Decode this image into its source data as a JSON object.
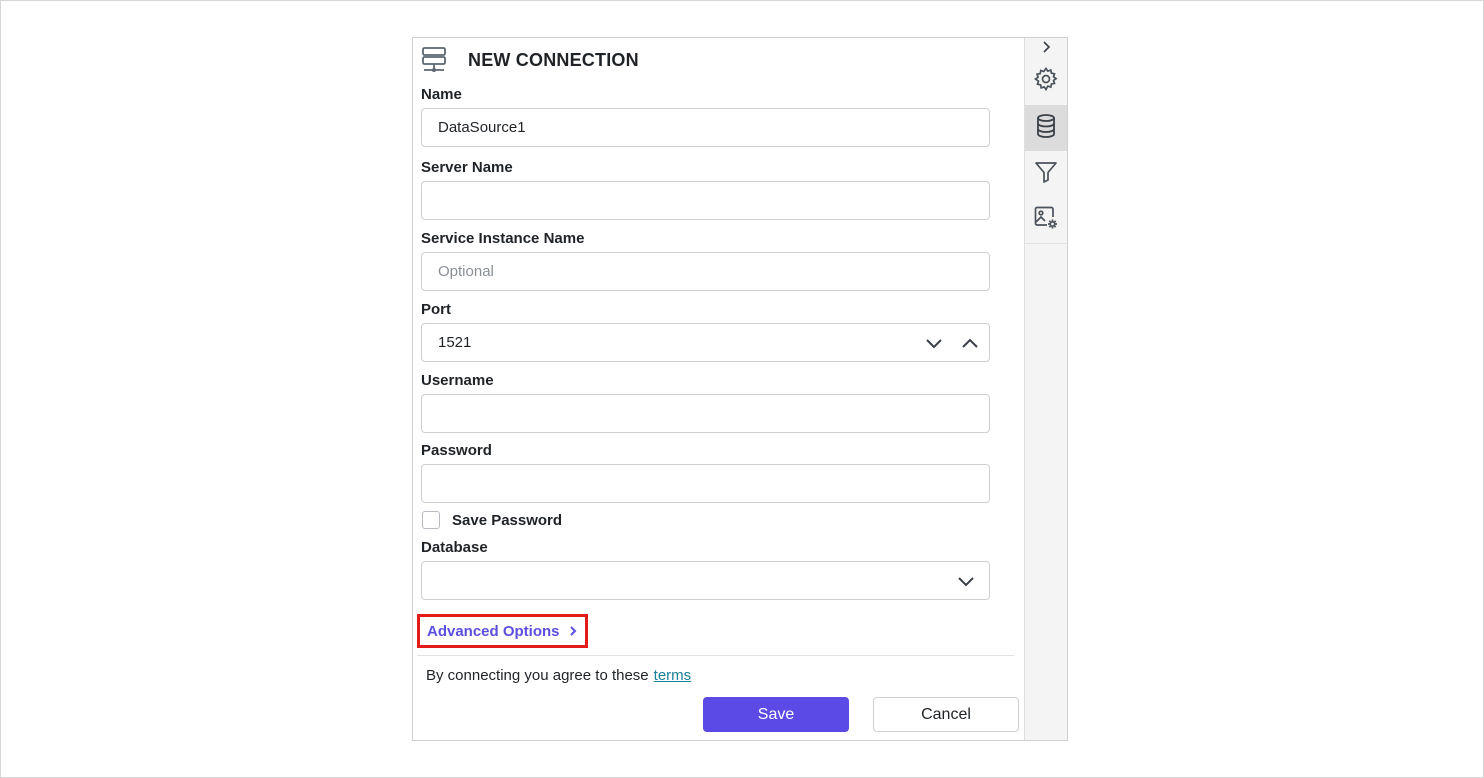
{
  "panel": {
    "title": "NEW CONNECTION",
    "title_icon": "server-icon"
  },
  "form": {
    "name": {
      "label": "Name",
      "value": "DataSource1"
    },
    "server_name": {
      "label": "Server Name",
      "value": ""
    },
    "service_instance_name": {
      "label": "Service Instance Name",
      "placeholder": "Optional",
      "value": ""
    },
    "port": {
      "label": "Port",
      "value": "1521"
    },
    "username": {
      "label": "Username",
      "value": ""
    },
    "password": {
      "label": "Password",
      "value": ""
    },
    "save_password": {
      "label": "Save Password",
      "checked": false
    },
    "database": {
      "label": "Database",
      "value": ""
    }
  },
  "advanced_options": {
    "label": "Advanced Options"
  },
  "footer": {
    "terms_text": "By connecting you agree to these",
    "terms_link": "terms",
    "save_label": "Save",
    "cancel_label": "Cancel"
  },
  "sidebar": {
    "items": [
      {
        "name": "settings",
        "icon": "gear-icon",
        "active": false
      },
      {
        "name": "data-source",
        "icon": "database-icon",
        "active": true
      },
      {
        "name": "filter",
        "icon": "filter-icon",
        "active": false
      },
      {
        "name": "image-settings",
        "icon": "image-settings-icon",
        "active": false
      }
    ]
  },
  "colors": {
    "accent": "#5b4ae6",
    "link": "#1a7f9c",
    "advanced_link": "#5b4fe0",
    "highlight_border": "#e41b17"
  }
}
